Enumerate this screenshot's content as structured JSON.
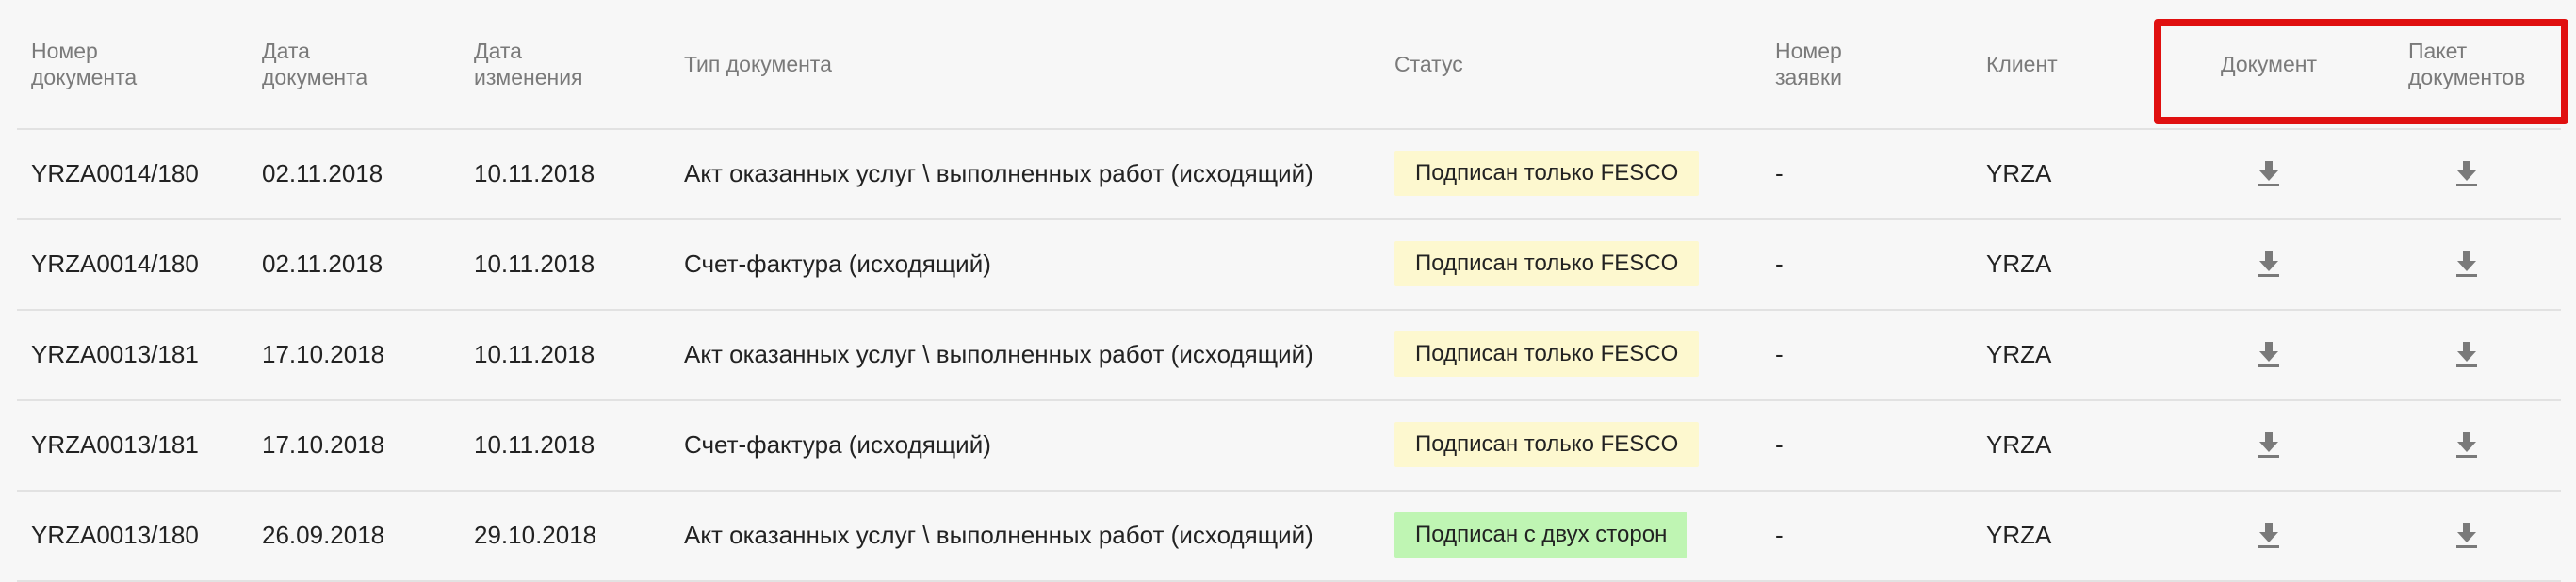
{
  "columns": [
    "Номер\nдокумента",
    "Дата\nдокумента",
    "Дата\nизменения",
    "Тип документа",
    "Статус",
    "Номер\nзаявки",
    "Клиент",
    "Документ",
    "Пакет\nдокументов"
  ],
  "rows": [
    {
      "number": "YRZA0014/180",
      "doc_date": "02.11.2018",
      "mod_date": "10.11.2018",
      "type": "Акт оказанных услуг \\ выполненных работ (исходящий)",
      "status": "Подписан только FESCO",
      "status_color": "#fdf8cf",
      "request": "-",
      "client": "YRZA"
    },
    {
      "number": "YRZA0014/180",
      "doc_date": "02.11.2018",
      "mod_date": "10.11.2018",
      "type": "Счет-фактура (исходящий)",
      "status": "Подписан только FESCO",
      "status_color": "#fdf8cf",
      "request": "-",
      "client": "YRZA"
    },
    {
      "number": "YRZA0013/181",
      "doc_date": "17.10.2018",
      "mod_date": "10.11.2018",
      "type": "Акт оказанных услуг \\ выполненных работ (исходящий)",
      "status": "Подписан только FESCO",
      "status_color": "#fdf8cf",
      "request": "-",
      "client": "YRZA"
    },
    {
      "number": "YRZA0013/181",
      "doc_date": "17.10.2018",
      "mod_date": "10.11.2018",
      "type": "Счет-фактура (исходящий)",
      "status": "Подписан только FESCO",
      "status_color": "#fdf8cf",
      "request": "-",
      "client": "YRZA"
    },
    {
      "number": "YRZA0013/180",
      "doc_date": "26.09.2018",
      "mod_date": "29.10.2018",
      "type": "Акт оказанных услуг \\ выполненных работ (исходящий)",
      "status": "Подписан с двух сторон",
      "status_color": "#bff5b3",
      "request": "-",
      "client": "YRZA"
    }
  ],
  "icons": {
    "download": "download-icon"
  },
  "colors": {
    "highlight": "#e01010",
    "icon": "#7a7a7a"
  }
}
